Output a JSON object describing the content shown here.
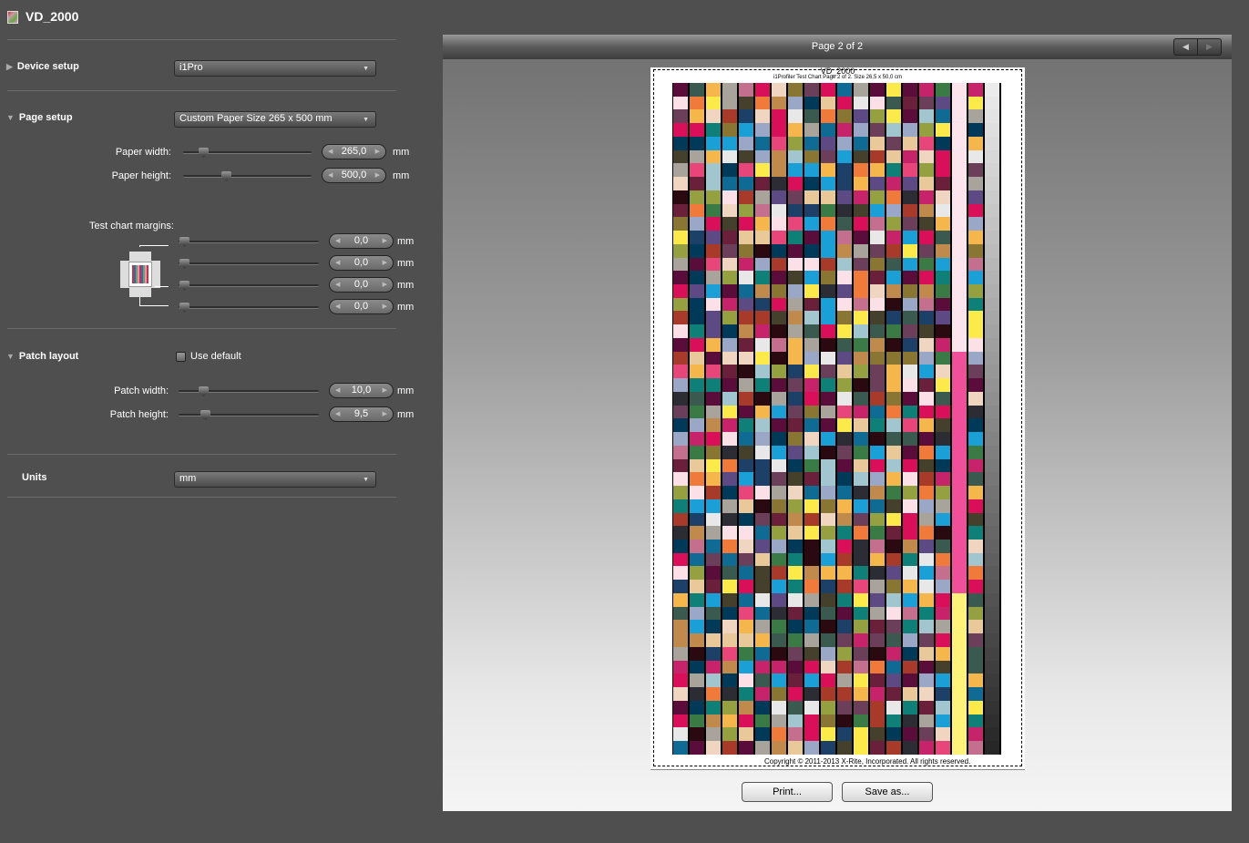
{
  "title": "VD_2000",
  "device_setup": {
    "label": "Device setup",
    "value": "i1Pro"
  },
  "page_setup": {
    "label": "Page setup",
    "value": "Custom Paper Size  265 x 500 mm",
    "paper_width": {
      "label": "Paper width:",
      "value": "265,0",
      "unit": "mm",
      "fraction": 0.15
    },
    "paper_height": {
      "label": "Paper height:",
      "value": "500,0",
      "unit": "mm",
      "fraction": 0.33
    },
    "margins": {
      "label": "Test chart margins:",
      "values": [
        {
          "value": "0,0",
          "unit": "mm"
        },
        {
          "value": "0,0",
          "unit": "mm"
        },
        {
          "value": "0,0",
          "unit": "mm"
        },
        {
          "value": "0,0",
          "unit": "mm"
        }
      ]
    }
  },
  "patch_layout": {
    "label": "Patch layout",
    "use_default": "Use default",
    "use_default_checked": false,
    "patch_width": {
      "label": "Patch width:",
      "value": "10,0",
      "unit": "mm"
    },
    "patch_height": {
      "label": "Patch height:",
      "value": "9,5",
      "unit": "mm"
    }
  },
  "units": {
    "label": "Units",
    "value": "mm"
  },
  "preview": {
    "page_label": "Page 2 of 2",
    "chart_title": "VD_2000",
    "chart_subtitle": "i1Profiler Test Chart Page 2 of 2. Size 26,5 x 50,0 cm",
    "copyright": "Copyright © 2011-2013 X-Rite, Incorporated. All rights reserved.",
    "print": "Print...",
    "save_as": "Save as..."
  }
}
